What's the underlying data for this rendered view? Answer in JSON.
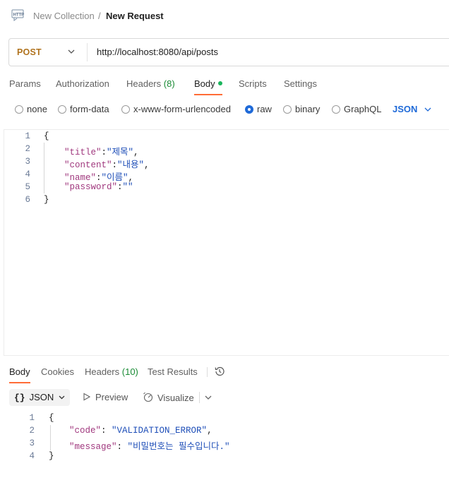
{
  "breadcrumb": {
    "icon": "http-icon",
    "collection": "New Collection",
    "separator": "/",
    "request": "New Request"
  },
  "request": {
    "method": "POST",
    "method_color": "#b0731e",
    "url": "http://localhost:8080/api/posts"
  },
  "tabs": [
    {
      "label": "Params"
    },
    {
      "label": "Authorization"
    },
    {
      "label": "Headers",
      "count": "(8)"
    },
    {
      "label": "Body",
      "active": true,
      "indicator": "green-dot"
    },
    {
      "label": "Scripts"
    },
    {
      "label": "Settings"
    }
  ],
  "body_types": [
    {
      "label": "none",
      "selected": false
    },
    {
      "label": "form-data",
      "selected": false
    },
    {
      "label": "x-www-form-urlencoded",
      "selected": false
    },
    {
      "label": "raw",
      "selected": true
    },
    {
      "label": "binary",
      "selected": false
    },
    {
      "label": "GraphQL",
      "selected": false
    }
  ],
  "raw_format": "JSON",
  "request_body": [
    {
      "n": "1",
      "parts": [
        [
          "pun",
          "{"
        ]
      ]
    },
    {
      "n": "2",
      "parts": [
        [
          "key",
          "\"title\""
        ],
        [
          "pun",
          ":"
        ],
        [
          "str",
          "\"제목\""
        ],
        [
          "pun",
          ","
        ]
      ]
    },
    {
      "n": "3",
      "parts": [
        [
          "key",
          "\"content\""
        ],
        [
          "pun",
          ":"
        ],
        [
          "str",
          "\"내용\""
        ],
        [
          "pun",
          ","
        ]
      ]
    },
    {
      "n": "4",
      "parts": [
        [
          "key",
          "\"name\""
        ],
        [
          "pun",
          ":"
        ],
        [
          "str",
          "\"이름\""
        ],
        [
          "pun",
          ","
        ]
      ]
    },
    {
      "n": "5",
      "parts": [
        [
          "key",
          "\"password\""
        ],
        [
          "pun",
          ":"
        ],
        [
          "str",
          "\"\""
        ]
      ]
    },
    {
      "n": "6",
      "parts": [
        [
          "pun",
          "}"
        ]
      ]
    }
  ],
  "response_tabs": [
    {
      "label": "Body",
      "active": true
    },
    {
      "label": "Cookies"
    },
    {
      "label": "Headers",
      "count": "(10)"
    },
    {
      "label": "Test Results"
    }
  ],
  "response_toolbar": {
    "format_braces": "{}",
    "format": "JSON",
    "preview": "Preview",
    "visualize": "Visualize"
  },
  "response_body": [
    {
      "n": "1",
      "parts": [
        [
          "pun",
          "{"
        ]
      ]
    },
    {
      "n": "2",
      "parts": [
        [
          "key",
          "\"code\""
        ],
        [
          "pun",
          ": "
        ],
        [
          "str",
          "\"VALIDATION_ERROR\""
        ],
        [
          "pun",
          ","
        ]
      ]
    },
    {
      "n": "3",
      "parts": [
        [
          "key",
          "\"message\""
        ],
        [
          "pun",
          ": "
        ],
        [
          "str",
          "\"비밀번호는 필수입니다.\""
        ]
      ]
    },
    {
      "n": "4",
      "parts": [
        [
          "pun",
          "}"
        ]
      ]
    }
  ],
  "colors": {
    "accent_orange": "#ff6c37",
    "selection_blue": "#1f6ad8",
    "key_color": "#a0387e",
    "string_color": "#1f4fb8",
    "count_green": "#1a8b35"
  }
}
